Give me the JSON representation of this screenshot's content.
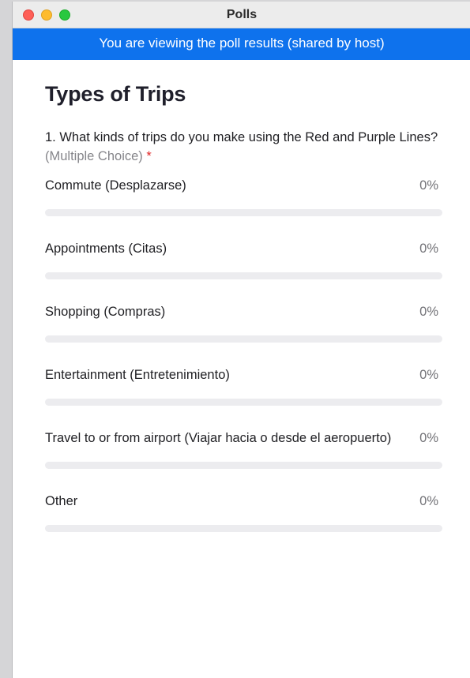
{
  "window": {
    "title": "Polls",
    "banner": "You are viewing the poll results (shared by host)"
  },
  "poll": {
    "title": "Types of Trips",
    "question": {
      "text": "1. What kinds of trips do you make using the Red and Purple Lines?",
      "type": "(Multiple Choice)",
      "required_marker": "*"
    },
    "options": [
      {
        "label": "Commute (Desplazarse)",
        "percent": "0%",
        "value": 0
      },
      {
        "label": "Appointments (Citas)",
        "percent": "0%",
        "value": 0
      },
      {
        "label": "Shopping (Compras)",
        "percent": "0%",
        "value": 0
      },
      {
        "label": "Entertainment (Entretenimiento)",
        "percent": "0%",
        "value": 0
      },
      {
        "label": "Travel to or from airport (Viajar hacia o desde el aeropuerto)",
        "percent": "0%",
        "value": 0
      },
      {
        "label": "Other",
        "percent": "0%",
        "value": 0
      }
    ]
  },
  "colors": {
    "banner": "#0e72ed",
    "bar_track": "#ececef",
    "required": "#e02828"
  }
}
